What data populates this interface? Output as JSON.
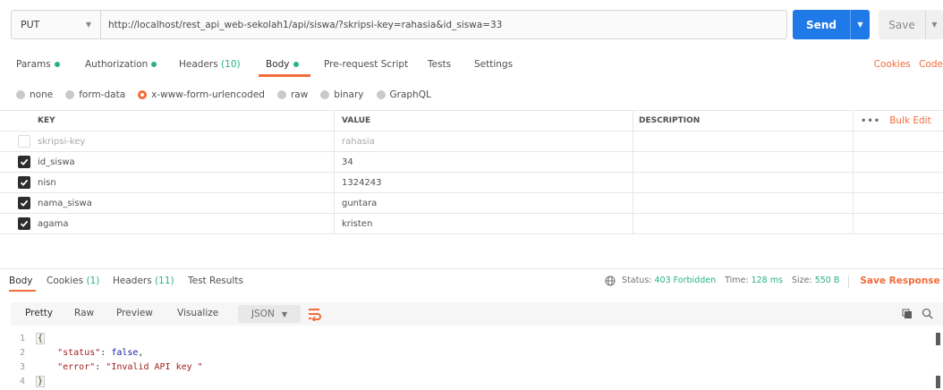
{
  "request": {
    "method": "PUT",
    "url": "http://localhost/rest_api_web-sekolah1/api/siswa/?skripsi-key=rahasia&id_siswa=33",
    "send_label": "Send",
    "save_label": "Save"
  },
  "req_tabs": {
    "params": "Params",
    "authorization": "Authorization",
    "headers": "Headers",
    "headers_count": "(10)",
    "body": "Body",
    "pre_request": "Pre-request Script",
    "tests": "Tests",
    "settings": "Settings",
    "cookies": "Cookies",
    "code": "Code"
  },
  "body_types": [
    "none",
    "form-data",
    "x-www-form-urlencoded",
    "raw",
    "binary",
    "GraphQL"
  ],
  "body_type_selected": "x-www-form-urlencoded",
  "table": {
    "headers": {
      "key": "KEY",
      "value": "VALUE",
      "description": "DESCRIPTION",
      "more": "•••",
      "bulk_edit": "Bulk Edit"
    },
    "rows": [
      {
        "key": "skripsi-key",
        "value": "rahasia",
        "checked": false
      },
      {
        "key": "id_siswa",
        "value": "34",
        "checked": true
      },
      {
        "key": "nisn",
        "value": "1324243",
        "checked": true
      },
      {
        "key": "nama_siswa",
        "value": "guntara",
        "checked": true
      },
      {
        "key": "agama",
        "value": "kristen",
        "checked": true
      }
    ]
  },
  "response": {
    "tabs": {
      "body": "Body",
      "cookies": "Cookies",
      "cookies_count": "(1)",
      "headers": "Headers",
      "headers_count": "(11)",
      "test_results": "Test Results"
    },
    "status_label": "Status:",
    "status_value": "403 Forbidden",
    "time_label": "Time:",
    "time_value": "128 ms",
    "size_label": "Size:",
    "size_value": "550 B",
    "save_response": "Save Response",
    "formats": [
      "Pretty",
      "Raw",
      "Preview",
      "Visualize"
    ],
    "format_selected": "Pretty",
    "language": "JSON",
    "code_lines": {
      "l1": "{",
      "l2_key": "\"status\"",
      "l2_val": "false",
      "l3_key": "\"error\"",
      "l3_val": "\"Invalid API key \"",
      "l4": "}"
    },
    "line_numbers": [
      "1",
      "2",
      "3",
      "4"
    ]
  },
  "colors": {
    "accent": "#f26b3a",
    "send": "#1f7ae8",
    "ok_green": "#26b47f"
  },
  "icons": [
    "chevron-down-icon",
    "globe-icon",
    "wrap-lines-icon",
    "copy-icon",
    "search-icon",
    "check-icon"
  ]
}
